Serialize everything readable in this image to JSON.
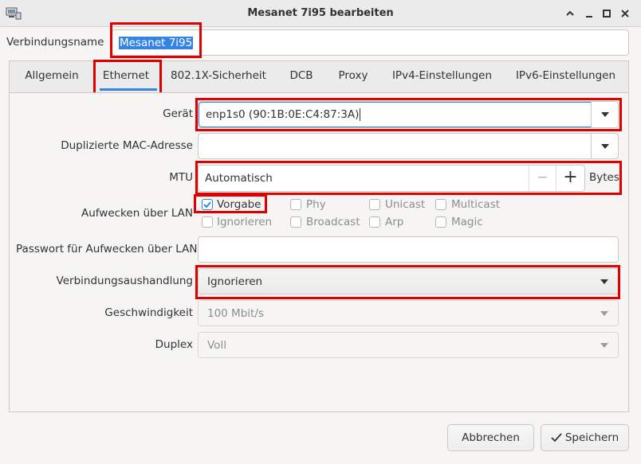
{
  "window": {
    "title": "Mesanet 7i95 bearbeiten",
    "app_icon": "network-computer-icon",
    "controls": [
      "minimize-icon",
      "maximize-icon",
      "close-icon"
    ]
  },
  "connection_name": {
    "label": "Verbindungsname",
    "value": "Mesanet 7i95"
  },
  "tabs": [
    {
      "label": "Allgemein"
    },
    {
      "label": "Ethernet",
      "active": true
    },
    {
      "label": "802.1X-Sicherheit"
    },
    {
      "label": "DCB"
    },
    {
      "label": "Proxy"
    },
    {
      "label": "IPv4-Einstellungen"
    },
    {
      "label": "IPv6-Einstellungen"
    }
  ],
  "ethernet": {
    "device": {
      "label": "Gerät",
      "value": "enp1s0 (90:1B:0E:C4:87:3A)"
    },
    "cloned_mac": {
      "label": "Duplizierte MAC-Adresse",
      "value": ""
    },
    "mtu": {
      "label": "MTU",
      "value": "Automatisch",
      "minus": "−",
      "plus": "+",
      "unit": "Bytes"
    },
    "wake_on_lan": {
      "label": "Aufwecken über LAN",
      "options": [
        {
          "label": "Vorgabe",
          "checked": true,
          "enabled": true
        },
        {
          "label": "Phy",
          "checked": false,
          "enabled": false
        },
        {
          "label": "Unicast",
          "checked": false,
          "enabled": false
        },
        {
          "label": "Multicast",
          "checked": false,
          "enabled": false
        },
        {
          "label": "Ignorieren",
          "checked": false,
          "enabled": false
        },
        {
          "label": "Broadcast",
          "checked": false,
          "enabled": false
        },
        {
          "label": "Arp",
          "checked": false,
          "enabled": false
        },
        {
          "label": "Magic",
          "checked": false,
          "enabled": false
        }
      ]
    },
    "wol_password": {
      "label": "Passwort für Aufwecken über LAN",
      "value": ""
    },
    "negotiation": {
      "label": "Verbindungsaushandlung",
      "value": "Ignorieren"
    },
    "speed": {
      "label": "Geschwindigkeit",
      "value": "100 Mbit/s"
    },
    "duplex": {
      "label": "Duplex",
      "value": "Voll"
    }
  },
  "buttons": {
    "cancel": "Abbrechen",
    "save": "Speichern"
  },
  "colors": {
    "highlight": "#e00000",
    "focus": "#3584e4",
    "selection": "#3584e4",
    "check": "#3584e4"
  }
}
